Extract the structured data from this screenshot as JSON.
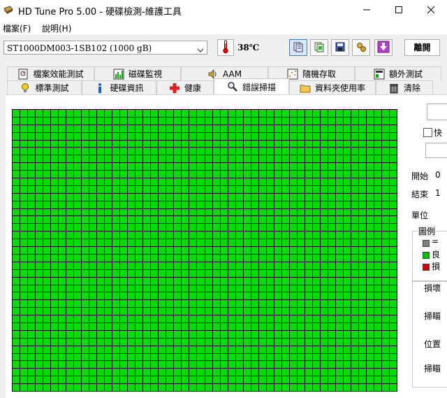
{
  "window": {
    "title": "HD Tune Pro  5.00 - 硬碟檢測-維護工具",
    "app_icon": "hd-tune-logo-icon",
    "controls": [
      "minimize-icon",
      "maximize-icon",
      "close-icon"
    ]
  },
  "menu": {
    "items": [
      {
        "label": "檔案(F)"
      },
      {
        "label": "說明(H)"
      }
    ]
  },
  "toolbar": {
    "drive_value": "ST1000DM003-1SB102 (1000 gB)",
    "temperature": "38℃",
    "buttons": [
      {
        "icon": "copy-info-icon"
      },
      {
        "icon": "copy-screen-icon"
      },
      {
        "icon": "save-disk-icon"
      },
      {
        "icon": "options-icon"
      },
      {
        "icon": "download-arrow-icon"
      }
    ],
    "exit_label": "離開"
  },
  "tabs_top": [
    {
      "label": "檔案效能測試",
      "icon": "file-benchmark-icon"
    },
    {
      "label": "磁碟監視",
      "icon": "bar-chart-icon"
    },
    {
      "label": "AAM",
      "icon": "speaker-icon"
    },
    {
      "label": "隨機存取",
      "icon": "random-access-icon"
    },
    {
      "label": "額外測試",
      "icon": "extra-tests-icon"
    }
  ],
  "tabs_bottom": [
    {
      "label": "標準測試",
      "icon": "lightbulb-icon"
    },
    {
      "label": "硬碟資訊",
      "icon": "info-icon"
    },
    {
      "label": "健康",
      "icon": "health-cross-icon"
    },
    {
      "label": "錯誤掃描",
      "icon": "magnifier-icon",
      "selected": true
    },
    {
      "label": "資料夾使用率",
      "icon": "folder-icon"
    },
    {
      "label": "清除",
      "icon": "trash-icon"
    }
  ],
  "scan": {
    "columns": 50,
    "rows": 37,
    "block_state": "good",
    "good_color": "#00dd00"
  },
  "side": {
    "quick_scan_label": "快",
    "start_label": "開始",
    "start_value": "0",
    "end_label": "結束",
    "end_value": "1",
    "unit_label": "單位",
    "legend_title": "圖例",
    "legend": [
      {
        "color": "#808080",
        "label": "="
      },
      {
        "color": "#00c000",
        "label": "良"
      },
      {
        "color": "#d00000",
        "label": "損"
      }
    ],
    "damaged_label": "損壞",
    "scan_label_1": "掃瞄",
    "position_label": "位置",
    "scan_label_2": "掃瞄"
  }
}
